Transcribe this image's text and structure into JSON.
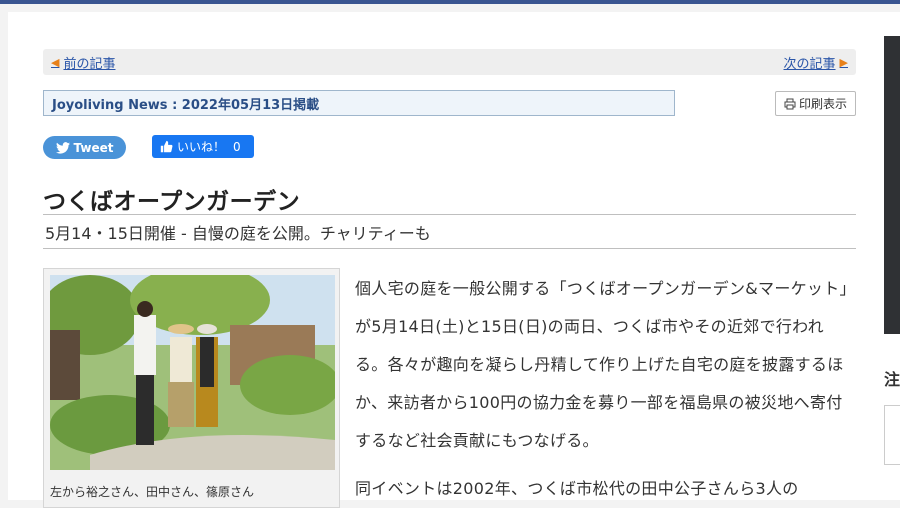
{
  "nav": {
    "prev_label": "前の記事",
    "next_label": "次の記事"
  },
  "pubinfo": "Joyoliving News : 2022年05月13日掲載",
  "print_label": "印刷表示",
  "social": {
    "tweet_label": "Tweet",
    "like_label": "いいね！",
    "like_count": "0"
  },
  "article": {
    "title": "つくばオープンガーデン",
    "subtitle": "5月14・15日開催 - 自慢の庭を公開。チャリティーも",
    "photo_caption": "左から裕之さん、田中さん、篠原さん",
    "paragraphs": [
      "個人宅の庭を一般公開する「つくばオープンガーデン&マーケット」が5月14日(土)と15日(日)の両日、つくば市やその近郊で行われる。各々が趣向を凝らし丹精して作り上げた自宅の庭を披露するほか、来訪者から100円の協力金を募り一部を福島県の被災地へ寄付するなど社会貢献にもつなげる。",
      "同イベントは2002年、つくば市松代の田中公子さんら3人の"
    ]
  },
  "sidebar": {
    "partial_text": "注"
  },
  "colors": {
    "top_bar": "#3a5591",
    "link": "#2a55a8",
    "arrow": "#e8811a",
    "tweet": "#4a93d8",
    "like": "#1877f2"
  },
  "icons": {
    "prev": "left-arrow-icon",
    "next": "right-arrow-icon",
    "print": "printer-icon",
    "tweet": "twitter-bird-icon",
    "like": "thumbs-up-icon"
  }
}
